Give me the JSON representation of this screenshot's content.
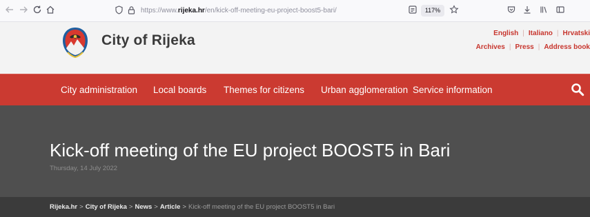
{
  "browser": {
    "url_prefix": "https://www.",
    "url_domain": "rijeka.hr",
    "url_path": "/en/kick-off-meeting-eu-project-boost5-bari/",
    "zoom": "117%",
    "icons": [
      "back-icon",
      "forward-icon",
      "reload-icon",
      "home-icon",
      "shield-icon",
      "lock-icon",
      "reader-view-icon",
      "bookmark-star-icon",
      "pocket-icon",
      "download-icon",
      "library-icon",
      "sidebar-icon"
    ]
  },
  "header": {
    "site_title": "City of Rijeka",
    "languages": [
      "English",
      "Italiano",
      "Hrvatski"
    ],
    "utility_links": [
      "Archives",
      "Press",
      "Address book"
    ],
    "accent_color": "#c7352d"
  },
  "nav": {
    "items": [
      "City administration",
      "Local boards",
      "Themes for citizens",
      "Urban agglomeration",
      "Service information"
    ],
    "background": "#cb3a31"
  },
  "article": {
    "title": "Kick-off meeting of the EU project BOOST5 in Bari",
    "date": "Thursday, 14 July 2022"
  },
  "breadcrumb": {
    "items": [
      "Rijeka.hr",
      "City of Rijeka",
      "News",
      "Article"
    ],
    "current": "Kick-off meeting of the EU project BOOST5 in Bari",
    "separator": ">"
  }
}
